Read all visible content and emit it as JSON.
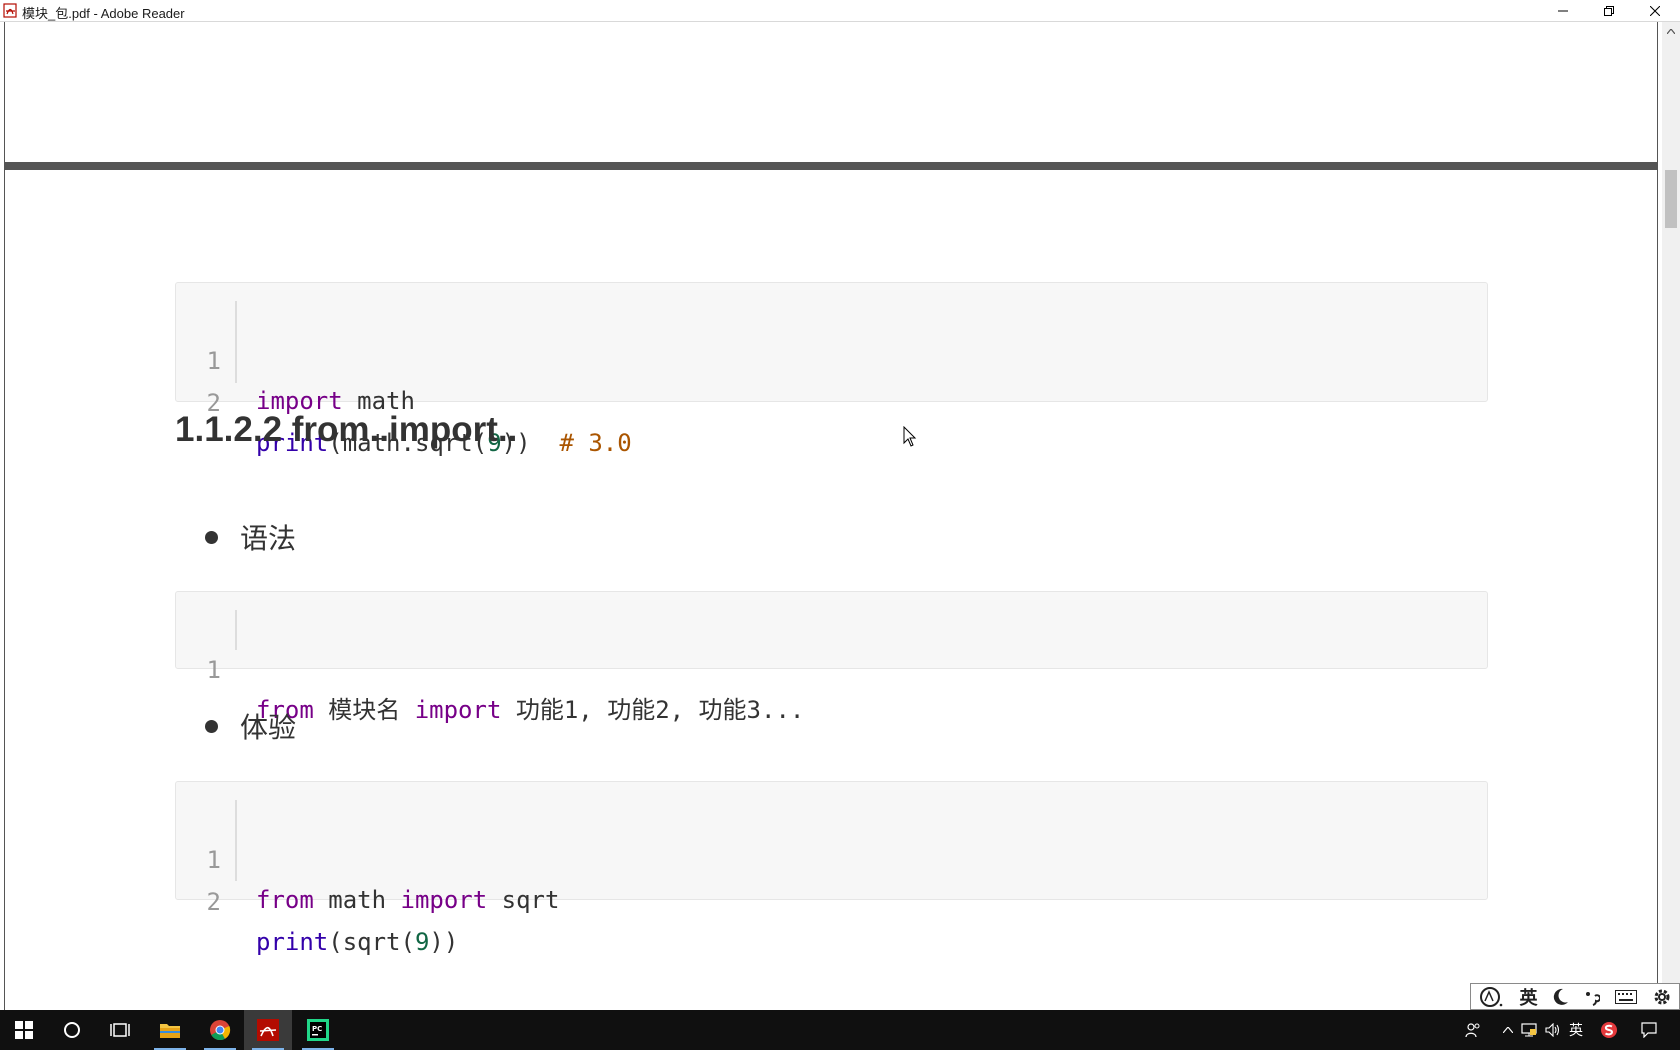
{
  "window": {
    "title": "模块_包.pdf - Adobe Reader"
  },
  "code_blocks": [
    {
      "lines": [
        {
          "num": "1",
          "tokens": [
            {
              "t": "import",
              "c": "kw"
            },
            {
              "t": " math",
              "c": ""
            }
          ]
        },
        {
          "num": "2",
          "tokens": [
            {
              "t": "print",
              "c": "bi"
            },
            {
              "t": "(math.sqrt(",
              "c": ""
            },
            {
              "t": "9",
              "c": "num"
            },
            {
              "t": "))  ",
              "c": ""
            },
            {
              "t": "# 3.0",
              "c": "cm"
            }
          ]
        }
      ]
    },
    {
      "lines": [
        {
          "num": "1",
          "tokens": [
            {
              "t": "from",
              "c": "kw"
            },
            {
              "t": " 模块名 ",
              "c": ""
            },
            {
              "t": "import",
              "c": "kw"
            },
            {
              "t": " 功能1, 功能2, 功能3...",
              "c": ""
            }
          ]
        }
      ]
    },
    {
      "lines": [
        {
          "num": "1",
          "tokens": [
            {
              "t": "from",
              "c": "kw"
            },
            {
              "t": " math ",
              "c": ""
            },
            {
              "t": "import",
              "c": "kw"
            },
            {
              "t": " sqrt",
              "c": ""
            }
          ]
        },
        {
          "num": "2",
          "tokens": [
            {
              "t": "print",
              "c": "bi"
            },
            {
              "t": "(sqrt(",
              "c": ""
            },
            {
              "t": "9",
              "c": "num"
            },
            {
              "t": "))",
              "c": ""
            }
          ]
        }
      ]
    }
  ],
  "document": {
    "heading": "1.1.2.2 from..import..",
    "bullet_syntax": "语法",
    "bullet_experience": "体验"
  },
  "ime": {
    "lang": "英"
  },
  "tray": {
    "lang": "英"
  },
  "colors": {
    "keyword": "#770088",
    "builtin": "#3300aa",
    "number": "#116644",
    "comment": "#aa5500"
  }
}
